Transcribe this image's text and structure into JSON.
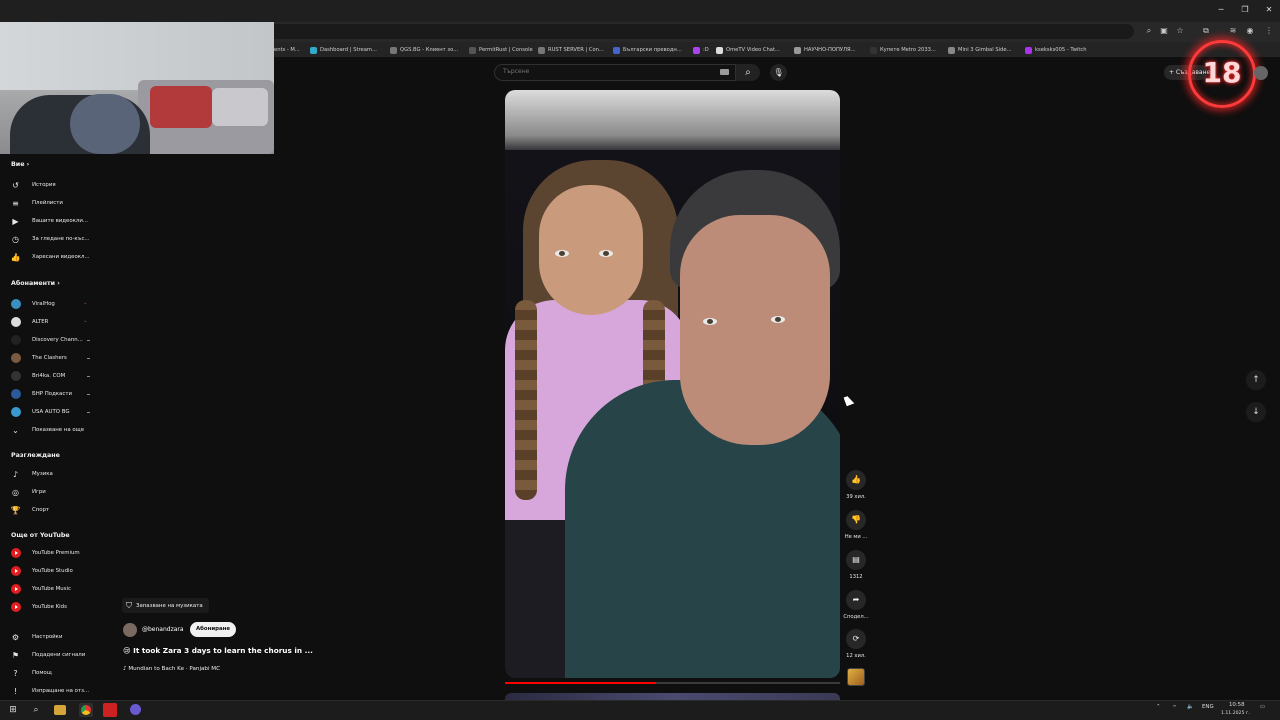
{
  "bookmarks": [
    {
      "label": "ents - M...",
      "color": "#4a7"
    },
    {
      "label": "Dashboard | Stream...",
      "color": "#3ac"
    },
    {
      "label": "QGS.BG - Клиент зо...",
      "color": "#777"
    },
    {
      "label": "PermitRust | Console",
      "color": "#555"
    },
    {
      "label": "RUST SERVER | Con...",
      "color": "#777"
    },
    {
      "label": "Български преводн...",
      "color": "#46c"
    },
    {
      "label": ":D",
      "color": "#a4e"
    },
    {
      "label": "OmeTV Video Chat...",
      "color": "#ddd"
    },
    {
      "label": "НАУЧНО-ПОПУЛЯ...",
      "color": "#999"
    },
    {
      "label": "Купете Metro 2033...",
      "color": "#333"
    },
    {
      "label": "Mini 3 Gimbal Side...",
      "color": "#888"
    },
    {
      "label": "kseksks005 - Twitch",
      "color": "#a3e"
    }
  ],
  "search": {
    "placeholder": "Търсене",
    "icon": "search-icon",
    "mic_icon": "mic-icon"
  },
  "header": {
    "create_label": "+ Създаване",
    "badge": "18"
  },
  "sidebar": {
    "you": {
      "title": "Вие",
      "items": [
        {
          "label": "История",
          "icon": "history-icon",
          "glyph": "↺"
        },
        {
          "label": "Плейлисти",
          "icon": "playlists-icon",
          "glyph": "≡"
        },
        {
          "label": "Вашите видеокли...",
          "icon": "your-videos-icon",
          "glyph": "▶"
        },
        {
          "label": "За гледане по-къс...",
          "icon": "watch-later-icon",
          "glyph": "◷"
        },
        {
          "label": "Харесани видеокл...",
          "icon": "liked-icon",
          "glyph": "👍"
        }
      ]
    },
    "subscriptions": {
      "title": "Абонаменти",
      "items": [
        {
          "label": "ViralHog",
          "color": "#3a8fc0"
        },
        {
          "label": "ALTER",
          "color": "#dddddd"
        },
        {
          "label": "Discovery Chann...",
          "color": "#222222"
        },
        {
          "label": "The Clashers",
          "color": "#7a5a40"
        },
        {
          "label": "Bri4ka. COM",
          "color": "#333333"
        },
        {
          "label": "БНР Подкасти",
          "color": "#2a5a9a"
        },
        {
          "label": "USA AUTO BG",
          "color": "#3a9ad0"
        }
      ],
      "show_more": "Показване на още"
    },
    "explore": {
      "title": "Разглеждане",
      "items": [
        {
          "label": "Музика",
          "icon": "music-icon",
          "glyph": "♪"
        },
        {
          "label": "Игри",
          "icon": "games-icon",
          "glyph": "◎"
        },
        {
          "label": "Спорт",
          "icon": "sports-icon",
          "glyph": "🏆"
        }
      ]
    },
    "more_youtube": {
      "title": "Още от YouTube",
      "items": [
        {
          "label": "YouTube Premium"
        },
        {
          "label": "YouTube Studio"
        },
        {
          "label": "YouTube Music"
        },
        {
          "label": "YouTube Kids"
        }
      ]
    },
    "footer": [
      {
        "label": "Настройки",
        "icon": "settings-icon",
        "glyph": "⚙"
      },
      {
        "label": "Подадени сигнали",
        "icon": "flag-icon",
        "glyph": "⚑"
      },
      {
        "label": "Помощ",
        "icon": "help-icon",
        "glyph": "?"
      },
      {
        "label": "Изпращане на отз...",
        "icon": "feedback-icon",
        "glyph": "!"
      }
    ]
  },
  "short": {
    "save_music": "Запазване на музиката",
    "channel": "@benandzara",
    "subscribe": "Абониране",
    "title": "😢 It took Zara 3 days to learn the chorus in ...",
    "song": "♪ Mundian to Bach Ke · Panjabi MC",
    "likes": "39 хил.",
    "dislike": "Не ми ...",
    "comments": "1312",
    "share": "Сподел...",
    "remix": "12 хил.",
    "progress": 0.45
  },
  "tray": {
    "lang": "ENG",
    "time": "10:58",
    "date": "1.11.2025 г."
  }
}
